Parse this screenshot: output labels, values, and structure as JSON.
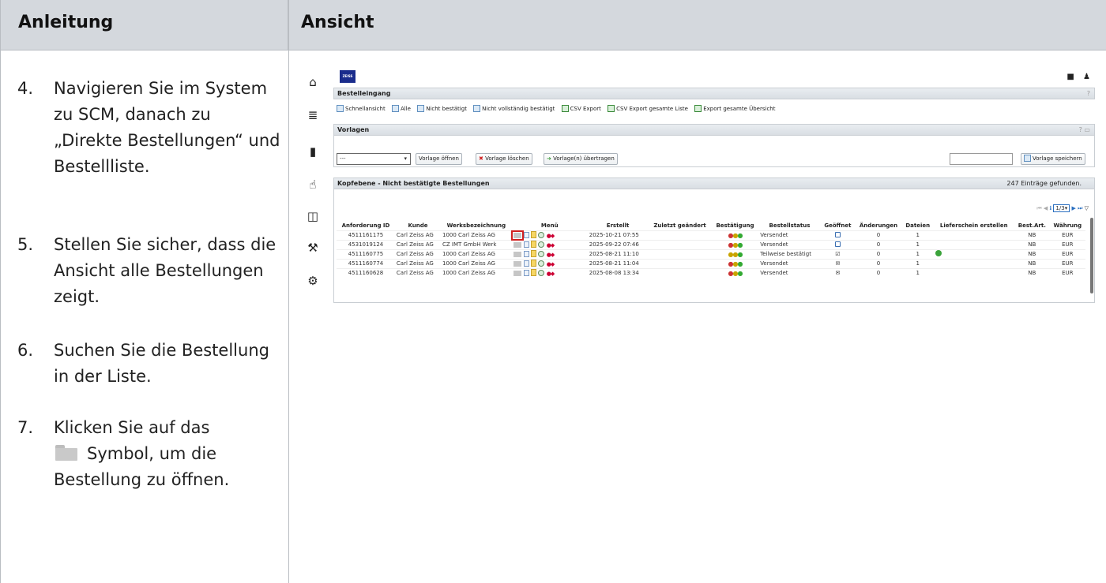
{
  "headers": {
    "left": "Anleitung",
    "right": "Ansicht"
  },
  "steps": [
    {
      "num": "4.",
      "text": "Navigieren Sie im System zu SCM, danach zu „Direkte Bestellungen“ und Bestellliste."
    },
    {
      "num": "5.",
      "text": "Stellen Sie sicher, dass die Ansicht alle Bestellungen zeigt."
    },
    {
      "num": "6.",
      "text": "Suchen Sie die Bestellung in der Liste."
    },
    {
      "num": "7.",
      "text_before": "Klicken Sie auf das",
      "text_after": "Symbol, um die Bestellung zu öffnen."
    }
  ],
  "screen": {
    "logo": "ZEISS",
    "rail_icons": [
      "home-icon",
      "database-icon",
      "copy-icon",
      "hand-icon",
      "bus-icon",
      "hammer-icon",
      "gear-icon"
    ],
    "panel1_title": "Bestelleingang",
    "panel1_help": "?",
    "links": [
      "Schnellansicht",
      "Alle",
      "Nicht bestätigt",
      "Nicht vollständig bestätigt",
      "CSV Export",
      "CSV Export gesamte Liste",
      "Export gesamte Übersicht"
    ],
    "panel2_title": "Vorlagen",
    "panel2_help": "? ▭",
    "template_select": "---",
    "btn_open": "Vorlage öffnen",
    "btn_delete": "Vorlage löschen",
    "btn_transfer": "Vorlage(n) übertragen",
    "btn_save": "Vorlage speichern",
    "panel3_title": "Kopfebene - Nicht bestätigte Bestellungen",
    "count_text": "247 Einträge gefunden.",
    "pager": "1/3",
    "columns": [
      "Anforderung ID",
      "Kunde",
      "Werksbezeichnung",
      "Menü",
      "Erstellt",
      "Zuletzt geändert",
      "Bestätigung",
      "Bestellstatus",
      "Geöffnet",
      "Änderungen",
      "Dateien",
      "Lieferschein erstellen",
      "Best.Art.",
      "Währung"
    ],
    "rows": [
      {
        "id": "4511161175",
        "kunde": "Carl Zeiss AG",
        "werk": "1000 Carl Zeiss AG",
        "erstellt": "2025-10-21 07:55",
        "status": "Versendet",
        "aenderungen": "0",
        "dateien": "1",
        "art": "NB",
        "waehrung": "EUR"
      },
      {
        "id": "4531019124",
        "kunde": "Carl Zeiss AG",
        "werk": "CZ IMT GmbH Werk",
        "erstellt": "2025-09-22 07:46",
        "status": "Versendet",
        "aenderungen": "0",
        "dateien": "1",
        "art": "NB",
        "waehrung": "EUR"
      },
      {
        "id": "4511160775",
        "kunde": "Carl Zeiss AG",
        "werk": "1000 Carl Zeiss AG",
        "erstellt": "2025-08-21 11:10",
        "status": "Teilweise bestätigt",
        "aenderungen": "0",
        "dateien": "1",
        "art": "NB",
        "waehrung": "EUR"
      },
      {
        "id": "4511160774",
        "kunde": "Carl Zeiss AG",
        "werk": "1000 Carl Zeiss AG",
        "erstellt": "2025-08-21 11:04",
        "status": "Versendet",
        "aenderungen": "0",
        "dateien": "1",
        "art": "NB",
        "waehrung": "EUR"
      },
      {
        "id": "4511160628",
        "kunde": "Carl Zeiss AG",
        "werk": "1000 Carl Zeiss AG",
        "erstellt": "2025-08-08 13:34",
        "status": "Versendet",
        "aenderungen": "0",
        "dateien": "1",
        "art": "NB",
        "waehrung": "EUR"
      }
    ]
  }
}
